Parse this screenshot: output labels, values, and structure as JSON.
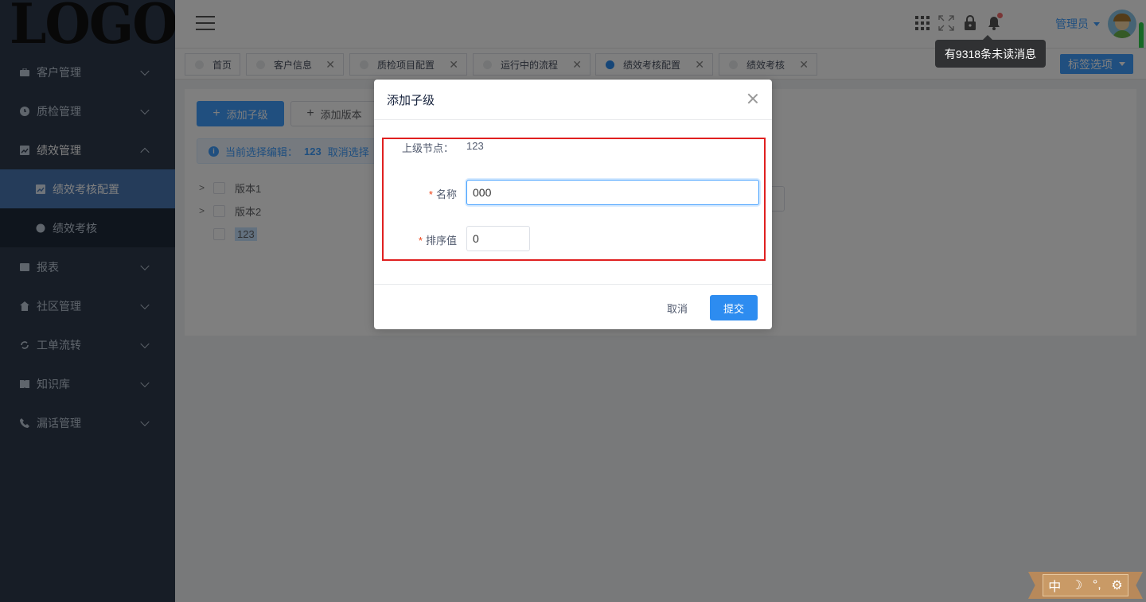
{
  "logo": {
    "text": "LOGO"
  },
  "sidebar": {
    "items": [
      {
        "label": "客户管理",
        "icon": "briefcase-icon"
      },
      {
        "label": "质检管理",
        "icon": "clock-icon"
      },
      {
        "label": "绩效管理",
        "icon": "chart-icon",
        "expanded": true,
        "children": [
          {
            "label": "绩效考核配置",
            "icon": "chart-icon",
            "active": true
          },
          {
            "label": "绩效考核",
            "icon": "circle-icon"
          }
        ]
      },
      {
        "label": "报表",
        "icon": "folder-icon"
      },
      {
        "label": "社区管理",
        "icon": "home-icon"
      },
      {
        "label": "工单流转",
        "icon": "refresh-icon"
      },
      {
        "label": "知识库",
        "icon": "book-icon"
      },
      {
        "label": "漏话管理",
        "icon": "phone-icon"
      }
    ]
  },
  "header": {
    "admin_label": "管理员",
    "tooltip": "有9318条未读消息",
    "icons": [
      "apps-icon",
      "fullscreen-icon",
      "lock-icon",
      "bell-icon"
    ]
  },
  "tabs": [
    {
      "label": "首页",
      "closable": false
    },
    {
      "label": "客户信息",
      "closable": true
    },
    {
      "label": "质检项目配置",
      "closable": true
    },
    {
      "label": "运行中的流程",
      "closable": true
    },
    {
      "label": "绩效考核配置",
      "closable": true,
      "active": true
    },
    {
      "label": "绩效考核",
      "closable": true
    }
  ],
  "tag_options_label": "标签选项",
  "content": {
    "add_child_label": "添加子级",
    "add_version_label": "添加版本",
    "info_prefix": "当前选择编辑：",
    "info_value": "123",
    "info_cancel": "取消选择",
    "tree": [
      "版本1",
      "版本2",
      "123"
    ]
  },
  "dialog": {
    "title": "添加子级",
    "parent_label": "上级节点：",
    "parent_value": "123",
    "name_label": "名称",
    "name_value": "000",
    "sort_label": "排序值",
    "sort_value": "0",
    "cancel_label": "取消",
    "submit_label": "提交"
  },
  "ime": {
    "lang": "中",
    "moon": "☽",
    "punct": "°,",
    "gear": "⚙"
  },
  "colors": {
    "primary": "#409eff",
    "sidebar_bg": "#2e3a4d",
    "highlight": "#e02020"
  }
}
